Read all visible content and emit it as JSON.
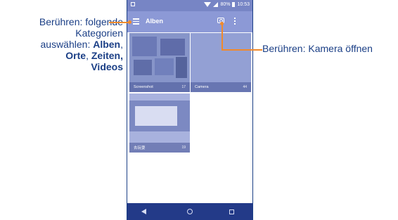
{
  "phone": {
    "status_time": "10:53",
    "status_battery": "80%",
    "appbar_title": "Alben"
  },
  "albums": [
    {
      "name": "Screenshot",
      "count": "17"
    },
    {
      "name": "Camera",
      "count": "44"
    },
    {
      "name": "去玩耍",
      "count": "19"
    }
  ],
  "callouts": {
    "left_line1": "Berühren: folgende",
    "left_line2": "Kategorien",
    "left_line3_prefix": "auswählen: ",
    "left_line3_bold": "Alben",
    "left_line3_suffix": ",",
    "left_line4_bold1": "Orte",
    "left_line4_mid": ", ",
    "left_line4_bold2": "Zeiten,",
    "left_line5_bold": "Videos",
    "right": "Berühren: Kamera öffnen"
  },
  "colors": {
    "text": "#1b3f86",
    "accent": "#f08a2c",
    "appbar": "#8c99d6",
    "statusbar": "#7785c5",
    "navbar": "#233a88"
  }
}
